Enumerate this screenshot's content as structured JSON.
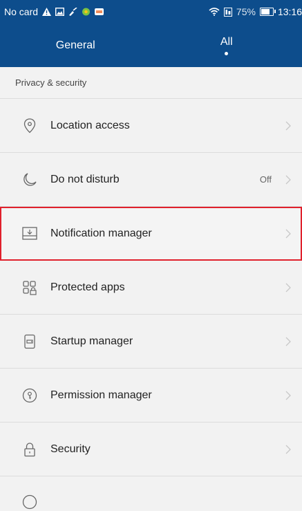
{
  "statusbar": {
    "carrier": "No card",
    "battery_percent": "75%",
    "battery_level": 0.75,
    "time": "13:16",
    "icons": [
      "warning-icon",
      "image-icon",
      "broom-icon",
      "leaf-app-icon",
      "message-icon",
      "wifi-icon",
      "data-icon"
    ]
  },
  "tabs": [
    {
      "label": "General",
      "active": false
    },
    {
      "label": "All",
      "active": true
    }
  ],
  "section": {
    "title": "Privacy & security"
  },
  "items": [
    {
      "label": "Location access",
      "value": "",
      "icon": "location-pin-icon"
    },
    {
      "label": "Do not disturb",
      "value": "Off",
      "icon": "moon-icon"
    },
    {
      "label": "Notification manager",
      "value": "",
      "icon": "notification-tray-icon",
      "highlighted": true
    },
    {
      "label": "Protected apps",
      "value": "",
      "icon": "protected-apps-icon"
    },
    {
      "label": "Startup manager",
      "value": "",
      "icon": "startup-icon"
    },
    {
      "label": "Permission manager",
      "value": "",
      "icon": "permission-icon"
    },
    {
      "label": "Security",
      "value": "",
      "icon": "lock-icon"
    }
  ],
  "colors": {
    "header": "#0d4d8c",
    "background": "#f2f2f2",
    "highlight_border": "#e0202c"
  }
}
